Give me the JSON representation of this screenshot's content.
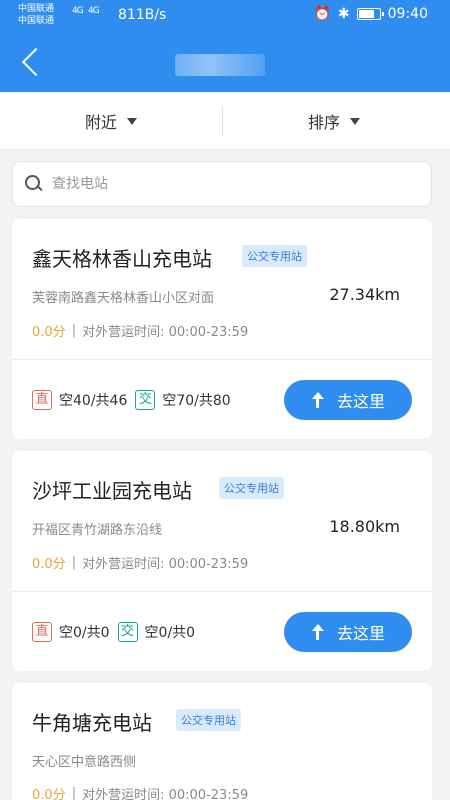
{
  "status_bar": {
    "carrier1": "中国联通",
    "carrier2": "中国联通",
    "net1": "4G",
    "net2": "4G",
    "speed": "811B/s",
    "time": "09:40",
    "battery_level": 0.8,
    "icons": [
      "alarm-icon",
      "bluetooth-icon",
      "battery-icon"
    ]
  },
  "filters": {
    "nearby": "附近",
    "sort": "排序"
  },
  "search": {
    "placeholder": "查找电站"
  },
  "stations": [
    {
      "name": "鑫天格林香山充电站",
      "tag": "公交专用站",
      "address": "芙蓉南路鑫天格林香山小区对面",
      "distance": "27.34km",
      "score": "0.0分",
      "hours": "对外营运时间:  00:00-23:59",
      "dc_label": "直",
      "dc_text": "空40/共46",
      "ac_label": "交",
      "ac_text": "空70/共80",
      "go": "去这里"
    },
    {
      "name": "沙坪工业园充电站",
      "tag": "公交专用站",
      "address": "开福区青竹湖路东沿线",
      "distance": "18.80km",
      "score": "0.0分",
      "hours": "对外营运时间:  00:00-23:59",
      "dc_label": "直",
      "dc_text": "空0/共0",
      "ac_label": "交",
      "ac_text": "空0/共0",
      "go": "去这里"
    },
    {
      "name": "牛角塘充电站",
      "tag": "公交专用站",
      "address": "天心区中意路西侧",
      "distance": "",
      "score": "0.0分",
      "hours": "对外营运时间:  00:00-23:59"
    }
  ],
  "colors": {
    "primary": "#2f8df0",
    "score": "#e9a53a",
    "dc": "#e26a5e",
    "ac": "#1aa39a"
  }
}
